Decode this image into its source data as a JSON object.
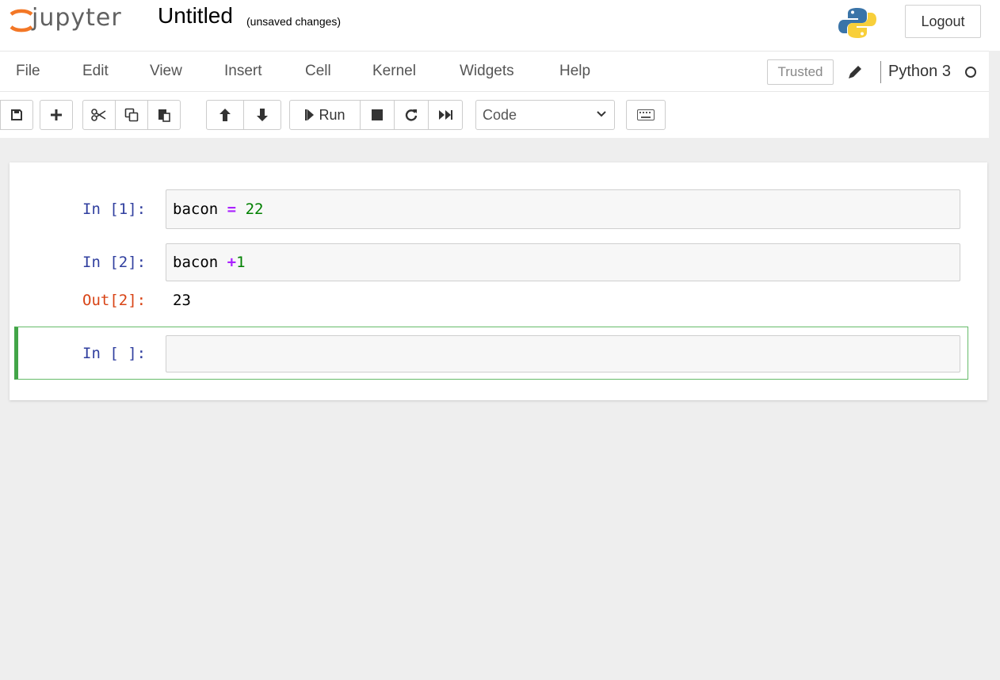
{
  "header": {
    "logo_text": "jupyter",
    "notebook_name": "Untitled",
    "save_status": "(unsaved changes)",
    "logout_label": "Logout"
  },
  "menubar": {
    "items": [
      "File",
      "Edit",
      "View",
      "Insert",
      "Cell",
      "Kernel",
      "Widgets",
      "Help"
    ],
    "trusted_label": "Trusted",
    "kernel_name": "Python 3"
  },
  "toolbar": {
    "run_label": "Run",
    "cell_type": "Code",
    "icons": [
      "save-icon",
      "plus-icon",
      "scissors-icon",
      "copy-icon",
      "paste-icon",
      "arrow-up-icon",
      "arrow-down-icon",
      "run-icon",
      "stop-icon",
      "restart-icon",
      "fast-forward-icon",
      "keyboard-icon"
    ]
  },
  "cells": [
    {
      "prompt": "In [1]:",
      "code": {
        "name": "bacon",
        "op": "=",
        "value": "22"
      }
    },
    {
      "prompt": "In [2]:",
      "code": {
        "name": "bacon",
        "op": "+",
        "value": "1"
      },
      "output_prompt": "Out[2]:",
      "output": "23"
    },
    {
      "prompt": "In [ ]:",
      "code": {
        "name": "",
        "op": "",
        "value": ""
      }
    }
  ],
  "colors": {
    "selected_cell_border": "#42a548",
    "in_prompt": "#303f9f",
    "out_prompt": "#d84315",
    "logo_orange": "#f37726"
  }
}
